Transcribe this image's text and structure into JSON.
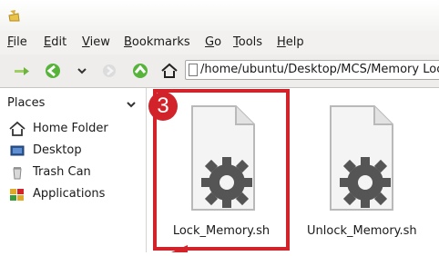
{
  "menu": {
    "file": "File",
    "edit": "Edit",
    "view": "View",
    "bookmarks": "Bookmarks",
    "go": "Go",
    "tools": "Tools",
    "help": "Help"
  },
  "location": {
    "path": "/home/ubuntu/Desktop/MCS/Memory Lock"
  },
  "sidebar": {
    "header": "Places",
    "items": [
      {
        "label": "Home Folder",
        "icon": "home-icon"
      },
      {
        "label": "Desktop",
        "icon": "desktop-icon"
      },
      {
        "label": "Trash Can",
        "icon": "trash-icon"
      },
      {
        "label": "Applications",
        "icon": "applications-icon"
      }
    ]
  },
  "files": [
    {
      "name": "Lock_Memory.sh",
      "icon": "script-file-icon"
    },
    {
      "name": "Unlock_Memory.sh",
      "icon": "script-file-icon"
    }
  ],
  "annotation": {
    "step": "3",
    "color": "#d2232a"
  }
}
